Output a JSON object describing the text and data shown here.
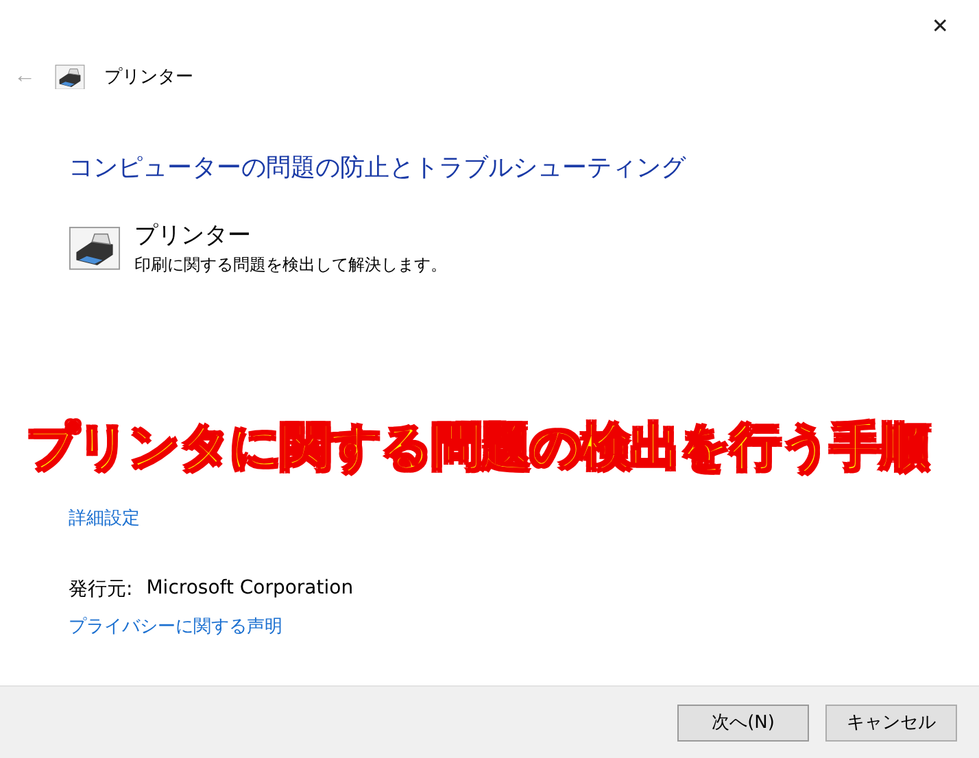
{
  "window": {
    "close": "✕",
    "back": "←",
    "title": "プリンター"
  },
  "heading": "コンピューターの問題の防止とトラブルシューティング",
  "troubleshooter": {
    "name": "プリンター",
    "description": "印刷に関する問題を検出して解決します。"
  },
  "caption": "プリンタに関する問題の検出を行う手順",
  "advanced_link": "詳細設定",
  "publisher": {
    "label": "発行元:",
    "value": "Microsoft Corporation"
  },
  "privacy_link": "プライバシーに関する声明",
  "buttons": [
    {
      "label": "次へ(N)",
      "kind": "primary"
    },
    {
      "label": "キャンセル",
      "kind": "secondary"
    }
  ]
}
